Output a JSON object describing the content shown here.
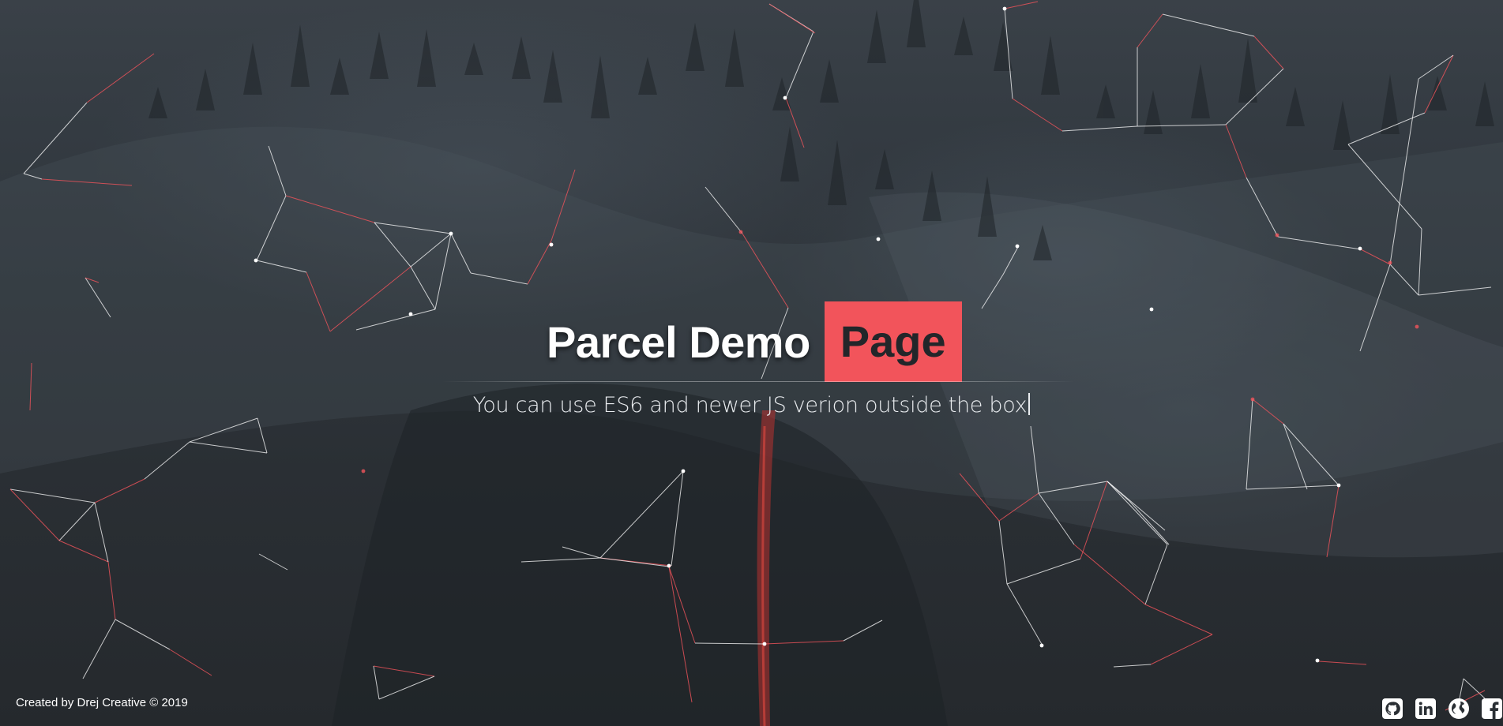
{
  "hero": {
    "title_main": "Parcel Demo",
    "title_highlight": "Page",
    "subtitle": "You can use ES6 and newer JS verion outside the box"
  },
  "footer": {
    "credit": "Created by Drej Creative © 2019"
  },
  "social_links": [
    {
      "icon": "github-icon"
    },
    {
      "icon": "linkedin-icon"
    },
    {
      "icon": "globe-icon"
    },
    {
      "icon": "facebook-icon"
    }
  ],
  "colors": {
    "accent": "#f2545b",
    "background": "#2e3439",
    "text": "#ffffff"
  }
}
